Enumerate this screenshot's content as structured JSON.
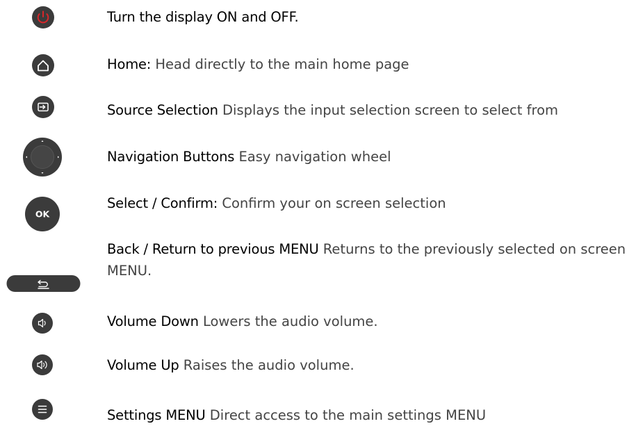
{
  "items": [
    {
      "title": "Turn the display ON and OFF.",
      "desc": "",
      "icon": "power-icon"
    },
    {
      "title": "Home:",
      "desc": " Head directly to the main home page",
      "icon": "home-icon"
    },
    {
      "title": "Source Selection",
      "desc": " Displays the input selection screen to select from",
      "icon": "source-input-icon"
    },
    {
      "title": "Navigation Buttons",
      "desc": " Easy navigation wheel",
      "icon": "navigation-wheel-icon"
    },
    {
      "title": "Select / Confirm:",
      "desc": " Confirm your on screen selection",
      "icon": "ok-icon",
      "icon_text": "OK"
    },
    {
      "title": "Back / Return to previous MENU",
      "desc": " Returns to the previously selected on screen MENU.",
      "icon": "back-return-icon"
    },
    {
      "title": "Volume Down",
      "desc": " Lowers the audio volume.",
      "icon": "volume-down-icon"
    },
    {
      "title": "Volume Up",
      "desc": " Raises the audio volume.",
      "icon": "volume-up-icon"
    },
    {
      "title": "Settings MENU",
      "desc": " Direct access to the main settings MENU",
      "icon": "settings-menu-icon"
    }
  ],
  "colors": {
    "button_dark": "#3b3b3b",
    "power_red": "#d8262a",
    "icon_line": "#ffffff"
  }
}
